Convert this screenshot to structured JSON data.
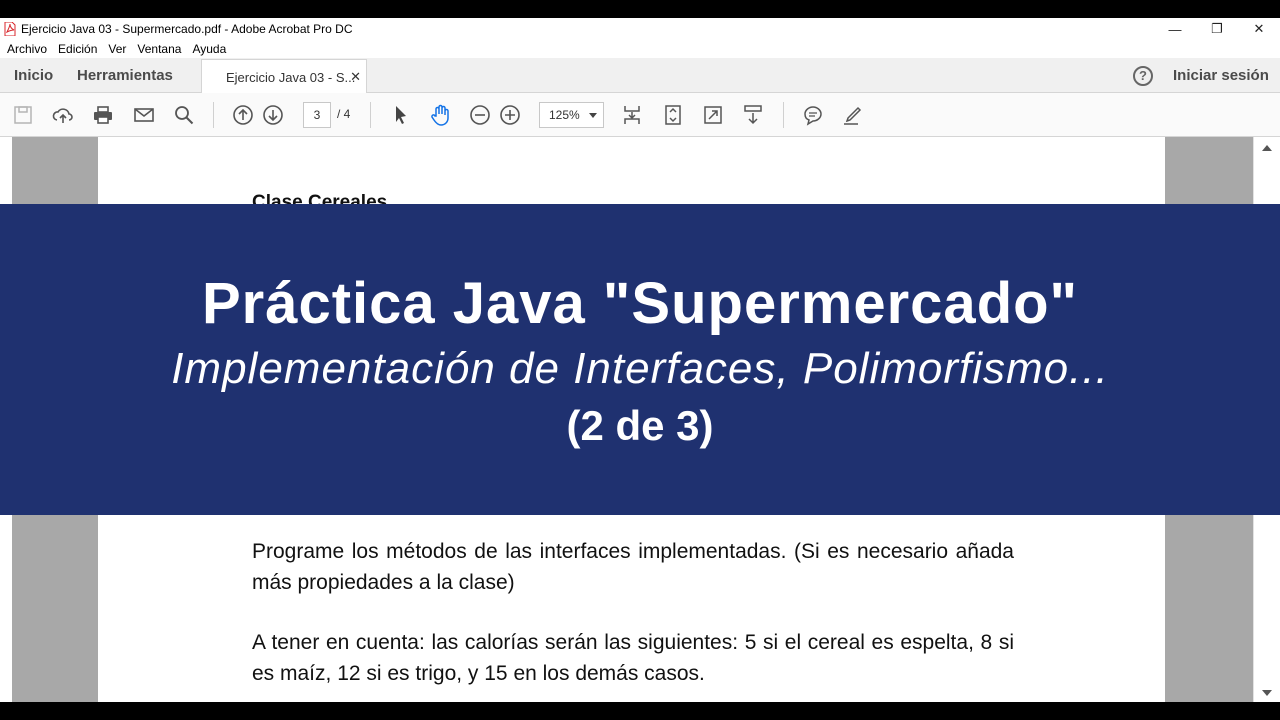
{
  "window": {
    "title": "Ejercicio Java 03 - Supermercado.pdf - Adobe Acrobat Pro DC",
    "minimize": "—",
    "restore": "❐",
    "close": "✕"
  },
  "menu": [
    "Archivo",
    "Edición",
    "Ver",
    "Ventana",
    "Ayuda"
  ],
  "tabs": {
    "home": "Inicio",
    "tools": "Herramientas",
    "document": "Ejercicio Java 03 - S...",
    "close": "✕",
    "help": "?",
    "signin": "Iniciar sesión"
  },
  "toolbar": {
    "page_current": "3",
    "page_total": "/  4",
    "zoom": "125%"
  },
  "document": {
    "heading": "Clase Cereales",
    "paragraph1": "Programe los métodos de las interfaces implementadas. (Si es necesario añada más propiedades a la clase)",
    "paragraph2": "A tener en cuenta: las calorías serán las siguientes: 5 si el cereal es espelta, 8 si es maíz, 12 si es trigo, y 15 en los demás casos."
  },
  "banner": {
    "title": "Práctica Java \"Supermercado\"",
    "subtitle": "Implementación de Interfaces, Polimorfismo...",
    "part": "(2 de 3)"
  },
  "colors": {
    "banner_bg": "#1f3170",
    "pdf_icon_red": "#d8262b"
  }
}
